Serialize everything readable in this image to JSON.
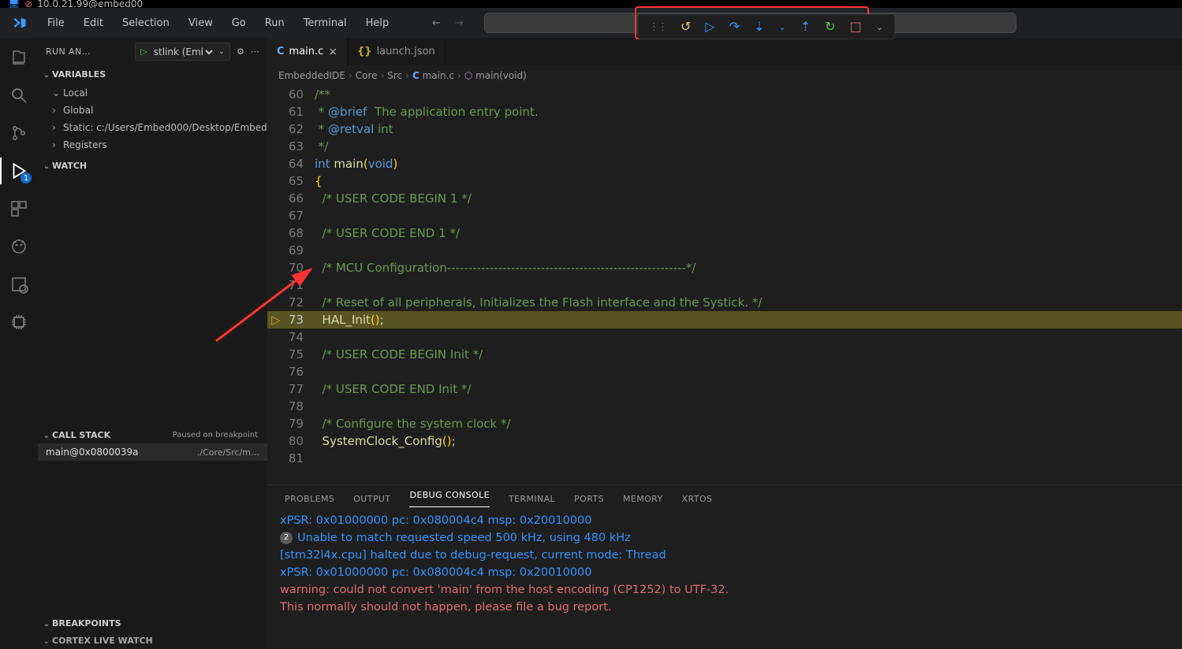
{
  "remote": {
    "host": "10.0.21.99@embed00"
  },
  "menu": {
    "file": "File",
    "edit": "Edit",
    "selection": "Selection",
    "view": "View",
    "go": "Go",
    "run": "Run",
    "terminal": "Terminal",
    "help": "Help"
  },
  "debugToolbarIcons": [
    "reset",
    "continue",
    "step-over",
    "step-into",
    "step-out",
    "restart",
    "stop",
    "more"
  ],
  "activitybar": {
    "debugBadge": "1"
  },
  "sidebar": {
    "title": "RUN AN…",
    "launchConfig": "stlink (Emb",
    "sections": {
      "variables": "VARIABLES",
      "watch": "WATCH",
      "callstack": "CALL STACK",
      "callstackStatus": "Paused on breakpoint",
      "breakpoints": "BREAKPOINTS",
      "cortex": "CORTEX LIVE WATCH"
    },
    "varTree": [
      {
        "label": "Local",
        "open": true
      },
      {
        "label": "Global",
        "open": false
      },
      {
        "label": "Static: c:/Users/Embed000/Desktop/Embed",
        "open": false
      },
      {
        "label": "Registers",
        "open": false
      }
    ],
    "callstackRows": [
      {
        "fn": "main@0x0800039a",
        "path": "./Core/Src/m…"
      }
    ]
  },
  "tabs": [
    {
      "icon": "C",
      "label": "main.c",
      "active": true,
      "closable": true
    },
    {
      "icon": "{}",
      "label": "launch.json",
      "active": false,
      "closable": false
    }
  ],
  "breadcrumb": [
    "EmbeddedIDE",
    "Core",
    "Src",
    "C main.c",
    "⬡ main(void)"
  ],
  "code": {
    "startLine": 60,
    "currentLine": 73,
    "lines": [
      {
        "n": 60,
        "html": "<span class='tok-cmt'>/**</span>"
      },
      {
        "n": 61,
        "html": "<span class='tok-cmt'> * </span><span class='tok-tag'>@brief</span><span class='tok-cmt'>  The application entry point.</span>"
      },
      {
        "n": 62,
        "html": "<span class='tok-cmt'> * </span><span class='tok-tag'>@retval</span><span class='tok-cmt'> int</span>"
      },
      {
        "n": 63,
        "html": "<span class='tok-cmt'> */</span>"
      },
      {
        "n": 64,
        "html": "<span class='tok-type'>int</span> <span class='tok-fn'>main</span><span class='tok-paren'>(</span><span class='tok-type'>void</span><span class='tok-paren'>)</span>"
      },
      {
        "n": 65,
        "html": "<span class='tok-br'>{</span>"
      },
      {
        "n": 66,
        "html": "  <span class='tok-cmt'>/* USER CODE BEGIN 1 */</span>"
      },
      {
        "n": 67,
        "html": ""
      },
      {
        "n": 68,
        "html": "  <span class='tok-cmt'>/* USER CODE END 1 */</span>"
      },
      {
        "n": 69,
        "html": ""
      },
      {
        "n": 70,
        "html": "  <span class='tok-cmt'>/* MCU Configuration--------------------------------------------------------*/</span>"
      },
      {
        "n": 71,
        "html": ""
      },
      {
        "n": 72,
        "html": "  <span class='tok-cmt'>/* Reset of all peripherals, Initializes the Flash interface and the Systick. */</span>"
      },
      {
        "n": 73,
        "html": "  <span class='tok-fn'>HAL_Init</span><span class='tok-paren'>(</span><span class='tok-paren'>)</span><span class='tok-punct'>;</span>"
      },
      {
        "n": 74,
        "html": ""
      },
      {
        "n": 75,
        "html": "  <span class='tok-cmt'>/* USER CODE BEGIN Init */</span>"
      },
      {
        "n": 76,
        "html": ""
      },
      {
        "n": 77,
        "html": "  <span class='tok-cmt'>/* USER CODE END Init */</span>"
      },
      {
        "n": 78,
        "html": ""
      },
      {
        "n": 79,
        "html": "  <span class='tok-cmt'>/* Configure the system clock */</span>"
      },
      {
        "n": 80,
        "html": "  <span class='tok-fn'>SystemClock_Config</span><span class='tok-paren'>(</span><span class='tok-paren'>)</span><span class='tok-punct'>;</span>"
      },
      {
        "n": 81,
        "html": ""
      }
    ]
  },
  "panel": {
    "tabs": [
      "PROBLEMS",
      "OUTPUT",
      "DEBUG CONSOLE",
      "TERMINAL",
      "PORTS",
      "MEMORY",
      "XRTOS"
    ],
    "activeTab": "DEBUG CONSOLE",
    "lines": [
      {
        "cls": "ln-blue",
        "text": "xPSR: 0x01000000 pc: 0x080004c4 msp: 0x20010000"
      },
      {
        "cls": "ln-blue",
        "badge": "2",
        "text": "Unable to match requested speed 500 kHz, using 480 kHz"
      },
      {
        "cls": "ln-blue",
        "text": "[stm32l4x.cpu] halted due to debug-request, current mode: Thread"
      },
      {
        "cls": "ln-blue",
        "text": "xPSR: 0x01000000 pc: 0x080004c4 msp: 0x20010000"
      },
      {
        "cls": "ln-red",
        "text": "warning: could not convert 'main' from the host encoding (CP1252) to UTF-32."
      },
      {
        "cls": "ln-red",
        "text": "This normally should not happen, please file a bug report."
      }
    ]
  }
}
